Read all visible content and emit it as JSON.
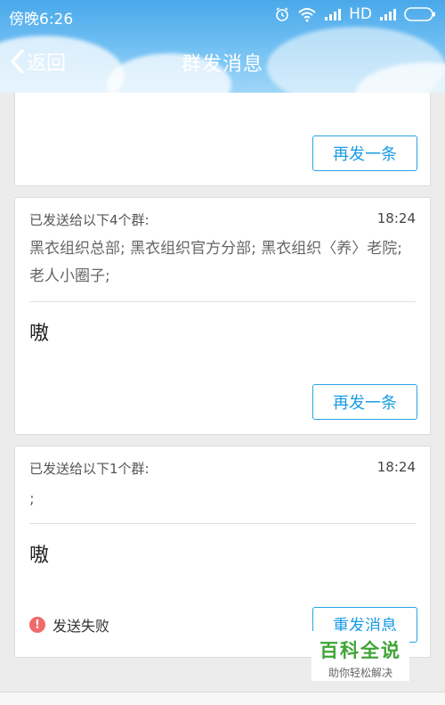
{
  "status_bar": {
    "time": "傍晚6:26",
    "network_label": "HD"
  },
  "navbar": {
    "back_label": "返回",
    "title": "群发消息"
  },
  "cards": [
    {
      "resend_label": "再发一条"
    },
    {
      "sent_to_label": "已发送给以下4个群:",
      "time": "18:24",
      "groups": "黑衣组织总部; 黑衣组织官方分部; 黑衣组织〈养〉老院; 老人小圈子;",
      "message": "嗷",
      "resend_label": "再发一条"
    },
    {
      "sent_to_label": "已发送给以下1个群:",
      "time": "18:24",
      "groups": ";",
      "message": "嗷",
      "fail_icon": "!",
      "fail_label": "发送失败",
      "resend_label": "重发消息"
    }
  ],
  "watermark": {
    "title": "百科全说",
    "subtitle": "助你轻松解决"
  },
  "colors": {
    "accent": "#1a9be5",
    "header_blue": "#4aa8ea",
    "fail_red": "#f06a6a",
    "watermark_green": "#3fa535"
  }
}
